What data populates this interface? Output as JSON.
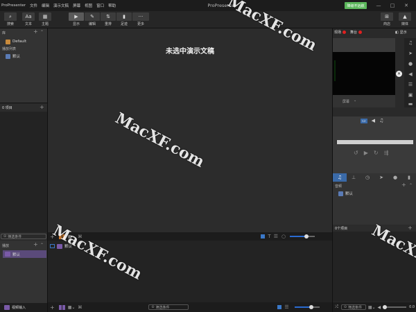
{
  "app": {
    "title": "ProPresenter",
    "register_btn": "降级不远航"
  },
  "menu": [
    "ProPresenter",
    "文件",
    "编辑",
    "演示文稿",
    "屏幕",
    "视图",
    "窗口",
    "帮助"
  ],
  "toolbar": {
    "left": [
      {
        "label": "搜索",
        "icon": "search-icon",
        "glyph": "🔍"
      },
      {
        "label": "文本",
        "icon": "text-icon",
        "glyph": "Aa"
      },
      {
        "label": "主题",
        "icon": "theme-icon",
        "glyph": "▦"
      }
    ],
    "center": [
      {
        "label": "显示",
        "icon": "play-icon",
        "glyph": "▶"
      },
      {
        "label": "编辑",
        "icon": "pencil-icon",
        "glyph": "✎"
      },
      {
        "label": "重排",
        "icon": "reflow-icon",
        "glyph": "⇅"
      },
      {
        "label": "足迹",
        "icon": "notes-icon",
        "glyph": "▮"
      },
      {
        "label": "更多",
        "icon": "more-icon",
        "glyph": "···"
      }
    ],
    "right": [
      {
        "label": "商店",
        "icon": "store-icon",
        "glyph": "⊞"
      },
      {
        "label": "媒体",
        "icon": "media-icon",
        "glyph": "▲"
      }
    ]
  },
  "library": {
    "header": "库",
    "items": [
      {
        "label": "Default"
      }
    ],
    "playlists_header": "播放列表",
    "playlists": [
      {
        "label": "默认"
      }
    ]
  },
  "items_panel": {
    "header": "0 项目"
  },
  "filter_placeholder": "筛选条件",
  "playlist_panel": {
    "header": "播放",
    "items": [
      {
        "label": "默认"
      }
    ]
  },
  "video_input": "视频输入",
  "main": {
    "empty_message": "未选中演示文稿"
  },
  "bottom_list": {
    "items": [
      {
        "label": "默认"
      }
    ]
  },
  "right": {
    "preview_labels": {
      "live": "现场",
      "stage": "舞台",
      "show": "显示"
    },
    "screen_label": "屏幕",
    "library_header": "音频",
    "library_items": [
      {
        "label": "默认"
      }
    ],
    "items_header": "0个项目",
    "filter": "筛选条件",
    "volume": "0.0"
  },
  "watermark": "MacXF.com"
}
